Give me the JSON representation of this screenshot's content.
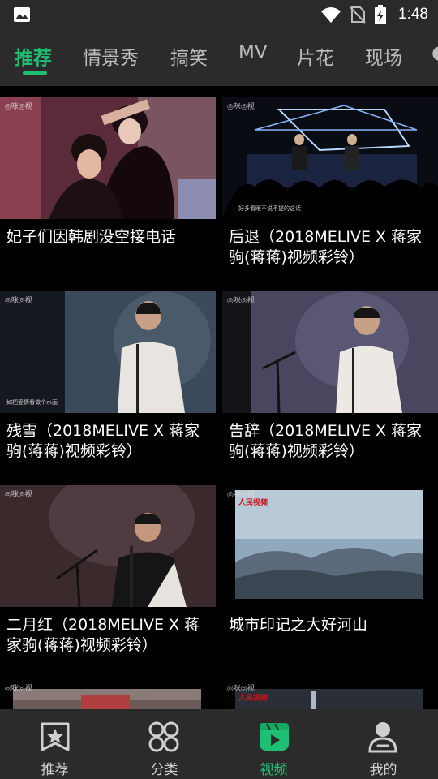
{
  "status_bar": {
    "time": "1:48",
    "icons": [
      "image-icon",
      "wifi-icon",
      "no-sim-icon",
      "battery-charging-icon"
    ]
  },
  "tabs": [
    {
      "label": "推荐",
      "active": true
    },
    {
      "label": "情景秀",
      "active": false
    },
    {
      "label": "搞笑",
      "active": false
    },
    {
      "label": "MV",
      "active": false
    },
    {
      "label": "片花",
      "active": false
    },
    {
      "label": "现场",
      "active": false
    },
    {
      "label": "grayscale-placeholder",
      "active": false
    }
  ],
  "videos": [
    {
      "title": "妃子们因韩剧没空接电话"
    },
    {
      "title": "后退（2018MELIVE X 蒋家驹(蒋蒋)视频彩铃）",
      "subtitle": "好多看眼不说不提的这话"
    },
    {
      "title": "残雪（2018MELIVE X 蒋家驹(蒋蒋)视频彩铃）",
      "subtitle": "如把爱情看做个水画"
    },
    {
      "title": "告辞（2018MELIVE X 蒋家驹(蒋蒋)视频彩铃）"
    },
    {
      "title": "二月红（2018MELIVE X 蒋家驹(蒋蒋)视频彩铃）"
    },
    {
      "title": "城市印记之大好河山",
      "logo": "人民视频"
    },
    {
      "title": "",
      "logo": ""
    },
    {
      "title": "",
      "logo": "人民视频"
    }
  ],
  "watermark": "◎咪◎视",
  "bottom_nav": [
    {
      "label": "推荐",
      "icon": "star-bookmark-icon",
      "active": false
    },
    {
      "label": "分类",
      "icon": "category-grid-icon",
      "active": false
    },
    {
      "label": "视频",
      "icon": "video-play-icon",
      "active": true
    },
    {
      "label": "我的",
      "icon": "person-icon",
      "active": false
    }
  ],
  "colors": {
    "accent": "#1fbf73",
    "bar": "#2b2b2b",
    "background": "#000000"
  }
}
